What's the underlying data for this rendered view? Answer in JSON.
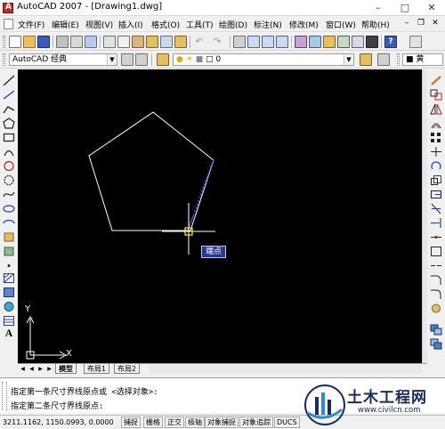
{
  "window": {
    "title": "AutoCAD 2007 - [Drawing1.dwg]"
  },
  "menu": {
    "items": [
      "文件(F)",
      "编辑(E)",
      "视图(V)",
      "插入(I)",
      "格式(O)",
      "工具(T)",
      "绘图(D)",
      "标注(N)",
      "修改(M)",
      "窗口(W)",
      "帮助(H)"
    ]
  },
  "toolbar": {
    "workspace": "AutoCAD 经典",
    "layer": "0",
    "color": "■ 黄"
  },
  "canvas": {
    "ucs_y": "Y",
    "ucs_x": "X",
    "tooltip": "端点"
  },
  "tabs": [
    "模型",
    "布局1",
    "布局2"
  ],
  "command": {
    "line1": "指定第一条尺寸界线原点或 <选择对象>:",
    "line2": "指定第二条尺寸界线原点:"
  },
  "status": {
    "coords": "3211.1162, 1150.0993, 0.0000",
    "buttons": [
      "捕捉",
      "栅格",
      "正交",
      "极轴",
      "对象捕捉",
      "对象追踪",
      "DUCS"
    ]
  },
  "watermark": {
    "name": "土木工程网",
    "url": "www.civilcn.com"
  },
  "colors": {
    "canvas": "#000000",
    "polygon": "#ffffff",
    "dimension_preview": "#3b5bff",
    "tooltip_bg": "#283a8c"
  }
}
